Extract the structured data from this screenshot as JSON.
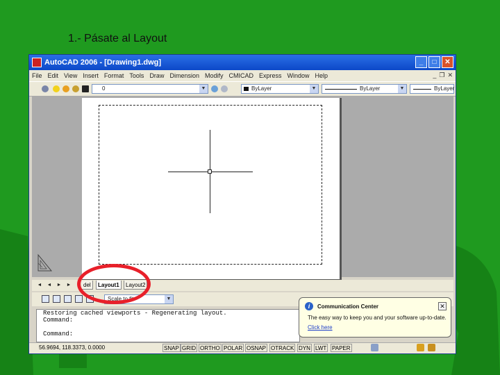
{
  "slide": {
    "title": "1.- Pásate al Layout"
  },
  "window": {
    "title": "AutoCAD 2006 - [Drawing1.dwg]"
  },
  "menu": [
    "File",
    "Edit",
    "View",
    "Insert",
    "Format",
    "Tools",
    "Draw",
    "Dimension",
    "Modify",
    "CMICAD",
    "Express",
    "Window",
    "Help"
  ],
  "toolbar": {
    "layer_value": "0",
    "color_value": "ByLayer",
    "linetype_value": "ByLayer",
    "lineweight_value": "ByLayer"
  },
  "tabs": [
    "del",
    "Layout1",
    "Layout2"
  ],
  "toolbar2": {
    "scale_value": "Scale to fit"
  },
  "command": {
    "lines": [
      "Restoring cached viewports - Regenerating layout.",
      "Command:",
      "",
      "Command:"
    ]
  },
  "status": {
    "coords": "56.9694, 118.3373, 0.0000",
    "buttons": [
      "SNAP",
      "GRID",
      "ORTHO",
      "POLAR",
      "OSNAP",
      "OTRACK",
      "DYN",
      "LWT",
      "PAPER"
    ]
  },
  "comm_center": {
    "title": "Communication Center",
    "body": "The easy way to keep you and your software up-to-date.",
    "link": "Click here"
  },
  "colors": {
    "slide_bg": "#1f9a1f",
    "title_bar": "#0c48c8",
    "highlight": "#e8202a"
  }
}
